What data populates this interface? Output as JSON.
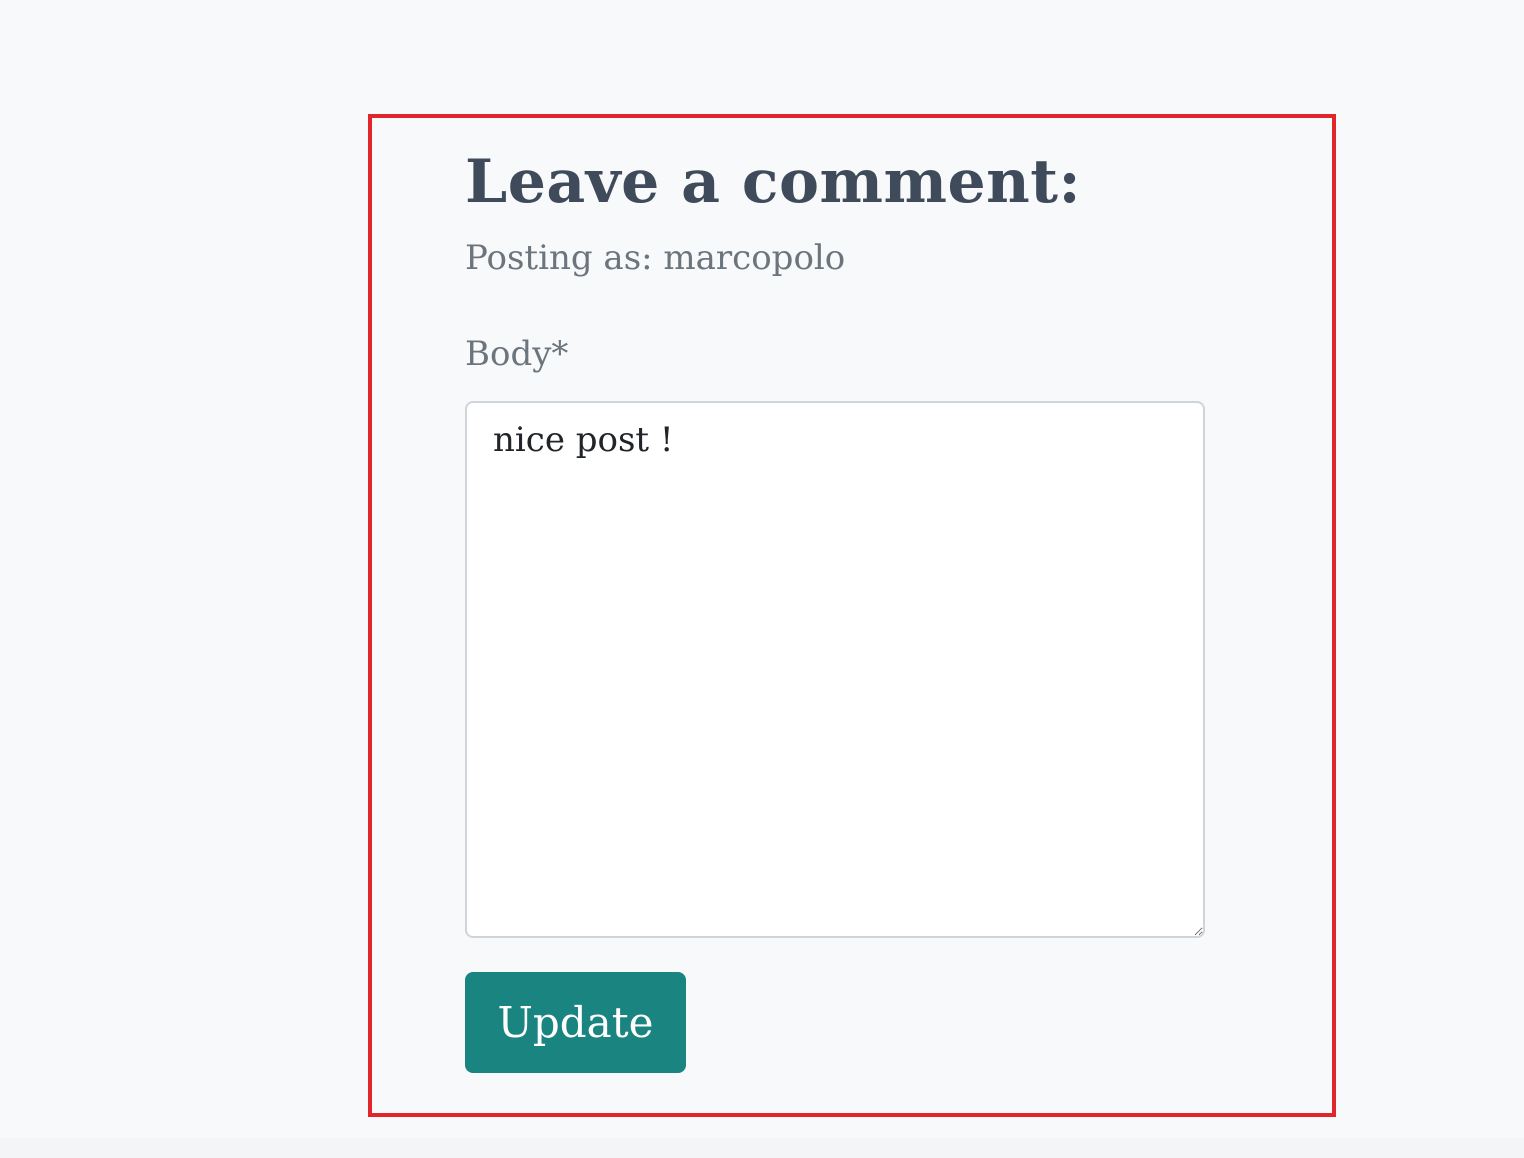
{
  "comment_form": {
    "title": "Leave a comment:",
    "posting_as": "Posting as: marcopolo",
    "body_label": "Body*",
    "body_value": "nice post !",
    "submit_label": "Update"
  },
  "colors": {
    "highlight_border": "#e0252b",
    "button_background": "#1a8480",
    "title_text": "#3f4a5a",
    "muted_text": "#6c757d",
    "page_background": "#f8f9fa"
  }
}
